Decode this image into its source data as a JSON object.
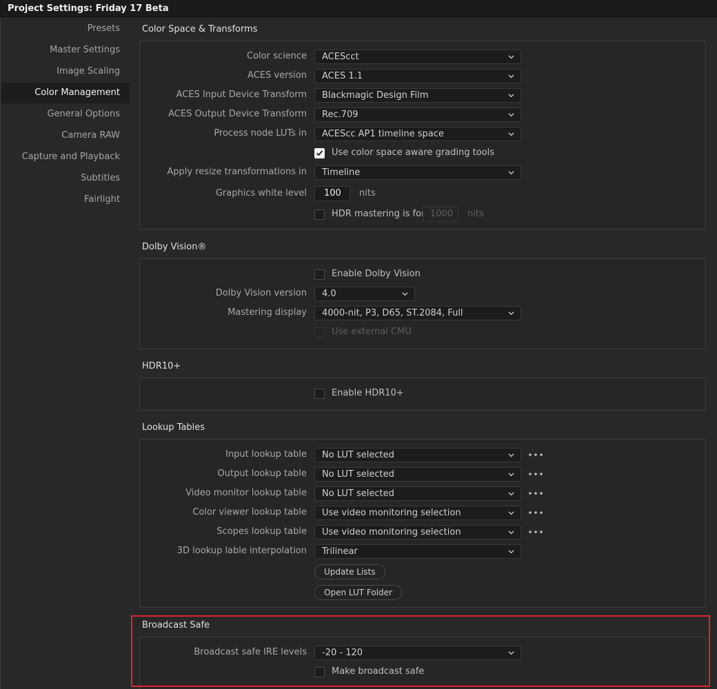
{
  "window": {
    "title": "Project Settings:  Friday 17 Beta"
  },
  "sidebar": {
    "items": [
      {
        "label": "Presets"
      },
      {
        "label": "Master Settings"
      },
      {
        "label": "Image Scaling"
      },
      {
        "label": "Color Management",
        "active": true
      },
      {
        "label": "General Options"
      },
      {
        "label": "Camera RAW"
      },
      {
        "label": "Capture and Playback"
      },
      {
        "label": "Subtitles"
      },
      {
        "label": "Fairlight"
      }
    ]
  },
  "color_space": {
    "title": "Color Space & Transforms",
    "color_science": {
      "label": "Color science",
      "value": "ACEScct"
    },
    "aces_version": {
      "label": "ACES version",
      "value": "ACES 1.1"
    },
    "aces_idt": {
      "label": "ACES Input Device Transform",
      "value": "Blackmagic Design Film"
    },
    "aces_odt": {
      "label": "ACES Output Device Transform",
      "value": "Rec.709"
    },
    "process_luts": {
      "label": "Process node LUTs in",
      "value": "ACEScc AP1 timeline space"
    },
    "grading_tools": {
      "label": "Use color space aware grading tools",
      "checked": true
    },
    "resize": {
      "label": "Apply resize transformations in",
      "value": "Timeline"
    },
    "white_level": {
      "label": "Graphics white level",
      "value": "100",
      "unit": "nits"
    },
    "hdr_mastering": {
      "label": "HDR mastering is for",
      "value": "1000",
      "unit": "nits",
      "checked": false
    }
  },
  "dolby": {
    "title": "Dolby Vision®",
    "enable": {
      "label": "Enable Dolby Vision",
      "checked": false
    },
    "version": {
      "label": "Dolby Vision version",
      "value": "4.0"
    },
    "mastering": {
      "label": "Mastering display",
      "value": "4000-nit, P3, D65, ST.2084, Full"
    },
    "external_cmu": {
      "label": "Use external CMU",
      "checked": false
    }
  },
  "hdr10": {
    "title": "HDR10+",
    "enable": {
      "label": "Enable HDR10+",
      "checked": false
    }
  },
  "luts": {
    "title": "Lookup Tables",
    "input": {
      "label": "Input lookup table",
      "value": "No LUT selected"
    },
    "output": {
      "label": "Output lookup table",
      "value": "No LUT selected"
    },
    "video_monitor": {
      "label": "Video monitor lookup table",
      "value": "No LUT selected"
    },
    "color_viewer": {
      "label": "Color viewer lookup table",
      "value": "Use video monitoring selection"
    },
    "scopes": {
      "label": "Scopes lookup table",
      "value": "Use video monitoring selection"
    },
    "interp": {
      "label": "3D lookup lable interpolation",
      "value": "Trilinear"
    },
    "update_btn": "Update Lists",
    "open_btn": "Open LUT Folder"
  },
  "broadcast": {
    "title": "Broadcast Safe",
    "ire": {
      "label": "Broadcast safe IRE levels",
      "value": "-20 - 120"
    },
    "make_safe": {
      "label": "Make broadcast safe",
      "checked": false
    }
  },
  "colors": {
    "highlight": "#e0252a",
    "background": "#282828",
    "panel": "#262626"
  }
}
